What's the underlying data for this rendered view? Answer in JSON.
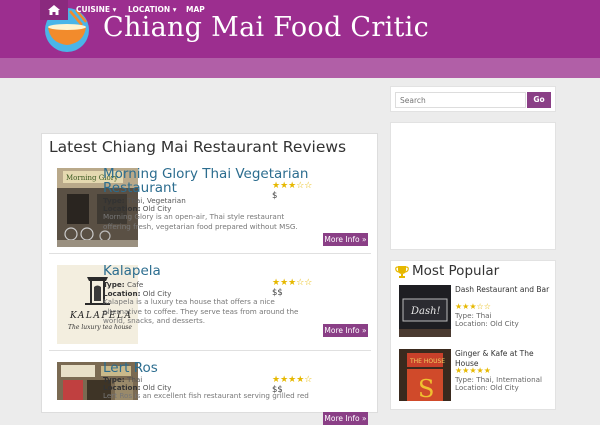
{
  "site": {
    "title": "Chiang Mai Food Critic"
  },
  "nav": {
    "items": [
      "CUISINE ▾",
      "LOCATION ▾",
      "MAP"
    ]
  },
  "search": {
    "placeholder": "Search",
    "button": "Go"
  },
  "main": {
    "title": "Latest Chiang Mai Restaurant Reviews",
    "reviews": [
      {
        "name": "Morning Glory Thai Vegetarian Restaurant",
        "stars": "★★★☆☆",
        "price": "$",
        "type_label": "Type:",
        "type": "Thai, Vegetarian",
        "location_label": "Location:",
        "location": "Old City",
        "desc": "Morning Glory is an open-air, Thai style restaurant offering fresh, vegetarian food prepared without MSG.",
        "button": "More Info »"
      },
      {
        "name": "Kalapela",
        "stars": "★★★☆☆",
        "price": "$$",
        "type_label": "Type:",
        "type": "Cafe",
        "location_label": "Location:",
        "location": "Old City",
        "desc": "Kalapela is a luxury tea house that offers a nice alternative to coffee. They serve teas from around the world, snacks, and desserts.",
        "button": "More Info »"
      },
      {
        "name": "Lert Ros",
        "stars": "★★★★☆",
        "price": "$$",
        "type_label": "Type:",
        "type": "Thai",
        "location_label": "Location:",
        "location": "Old City",
        "desc": "Lert Ros is an excellent fish restaurant serving grilled red",
        "button": "More Info »"
      }
    ]
  },
  "popular": {
    "title": "Most Popular",
    "items": [
      {
        "name": "Dash Restaurant and Bar",
        "stars": "★★★☆☆",
        "type_label": "Type:",
        "type": "Thai",
        "location_label": "Location:",
        "location": "Old City",
        "sign": "Dash!"
      },
      {
        "name": "Ginger & Kafe at The House",
        "stars": "★★★★★",
        "type_label": "Type:",
        "type": "Thai, International",
        "location_label": "Location:",
        "location": "Old City",
        "sign": "THE HOUSE"
      }
    ]
  },
  "images": {
    "kalapela_sign": "KALAPELA",
    "kalapela_sub": "The luxury tea house",
    "morning_sign": "Morning Glory"
  },
  "colors": {
    "brand": "#9c2e8f",
    "nav": "#b15fa7",
    "button": "#8a3f86",
    "link": "#2c6d8f",
    "star": "#e6b800"
  }
}
